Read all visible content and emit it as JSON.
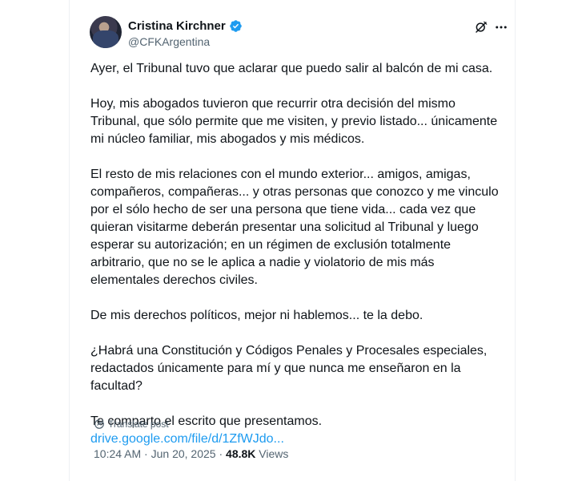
{
  "author": {
    "name": "Cristina Kirchner",
    "handle": "@CFKArgentina",
    "verified_color": "#1d9bf0"
  },
  "icons": {
    "verified": "verified-badge-icon",
    "grok": "grok-icon",
    "more": "more-options-icon",
    "translate": "translate-icon"
  },
  "tweet": {
    "paragraphs": [
      "Ayer, el Tribunal tuvo que aclarar que puedo salir al balcón de mi casa.",
      "Hoy, mis abogados tuvieron que recurrir otra decisión del mismo Tribunal, que sólo permite que me visiten, y previo listado... únicamente mi núcleo familiar, mis abogados y mis médicos.",
      "El resto de mis relaciones con el mundo exterior... amigos, amigas, compañeros, compañeras... y otras personas que conozco y me vinculo por el sólo hecho de ser una persona que tiene vida... cada vez que quieran visitarme deberán presentar una solicitud al Tribunal y luego esperar su autorización; en un régimen de exclusión totalmente arbitrario, que no se le aplica a nadie y violatorio de mis más elementales derechos civiles.",
      "De mis derechos políticos, mejor ni hablemos... te la debo.",
      "¿Habrá una Constitución y Códigos Penales y Procesales especiales, redactados únicamente para mí y que nunca me enseñaron en la facultad?",
      "Te comparto el escrito que presentamos."
    ],
    "link_text": "drive.google.com/file/d/1ZfWJdo..."
  },
  "translate_label": "Translate post",
  "meta": {
    "time": "10:24 AM",
    "separator": " · ",
    "date": "Jun 20, 2025",
    "views_count": "48.8K",
    "views_label": "Views"
  }
}
